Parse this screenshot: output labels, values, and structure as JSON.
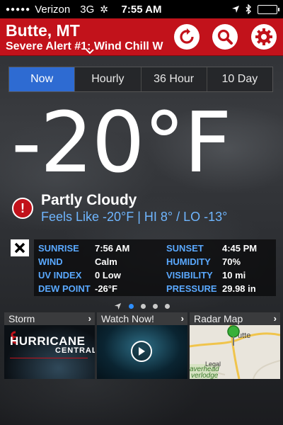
{
  "status": {
    "carrier": "Verizon",
    "network": "3G",
    "time": "7:55 AM"
  },
  "header": {
    "city": "Butte, MT",
    "alert": "Severe Alert #1: Wind Chill W"
  },
  "tabs": [
    {
      "label": "Now",
      "active": true
    },
    {
      "label": "Hourly",
      "active": false
    },
    {
      "label": "36 Hour",
      "active": false
    },
    {
      "label": "10 Day",
      "active": false
    }
  ],
  "current": {
    "temperature": "-20°F",
    "condition": "Partly Cloudy",
    "feels_like": "Feels Like -20°F | HI 8° / LO -13°"
  },
  "details": {
    "sunrise_label": "SUNRISE",
    "sunrise": "7:56 AM",
    "sunset_label": "SUNSET",
    "sunset": "4:45 PM",
    "wind_label": "WIND",
    "wind": "Calm",
    "humidity_label": "HUMIDITY",
    "humidity": "70%",
    "uv_label": "UV INDEX",
    "uv": "0 Low",
    "visibility_label": "VISIBILITY",
    "visibility": "10 mi",
    "dew_label": "DEW POINT",
    "dew": "-26°F",
    "pressure_label": "PRESSURE",
    "pressure": "29.98 in"
  },
  "cards": [
    {
      "title": "Storm",
      "art_line1": "HURRICANE",
      "art_line2": "CENTRAL"
    },
    {
      "title": "Watch Now!"
    },
    {
      "title": "Radar Map",
      "map_label1": "utte",
      "map_label2": "averhead",
      "map_label3": "Legal",
      "map_label4": "verlodge"
    }
  ],
  "colors": {
    "header_red": "#c2121b",
    "active_tab": "#2e6bd2",
    "label_blue": "#5aa9ff",
    "feels_blue": "#6fb6ff"
  }
}
